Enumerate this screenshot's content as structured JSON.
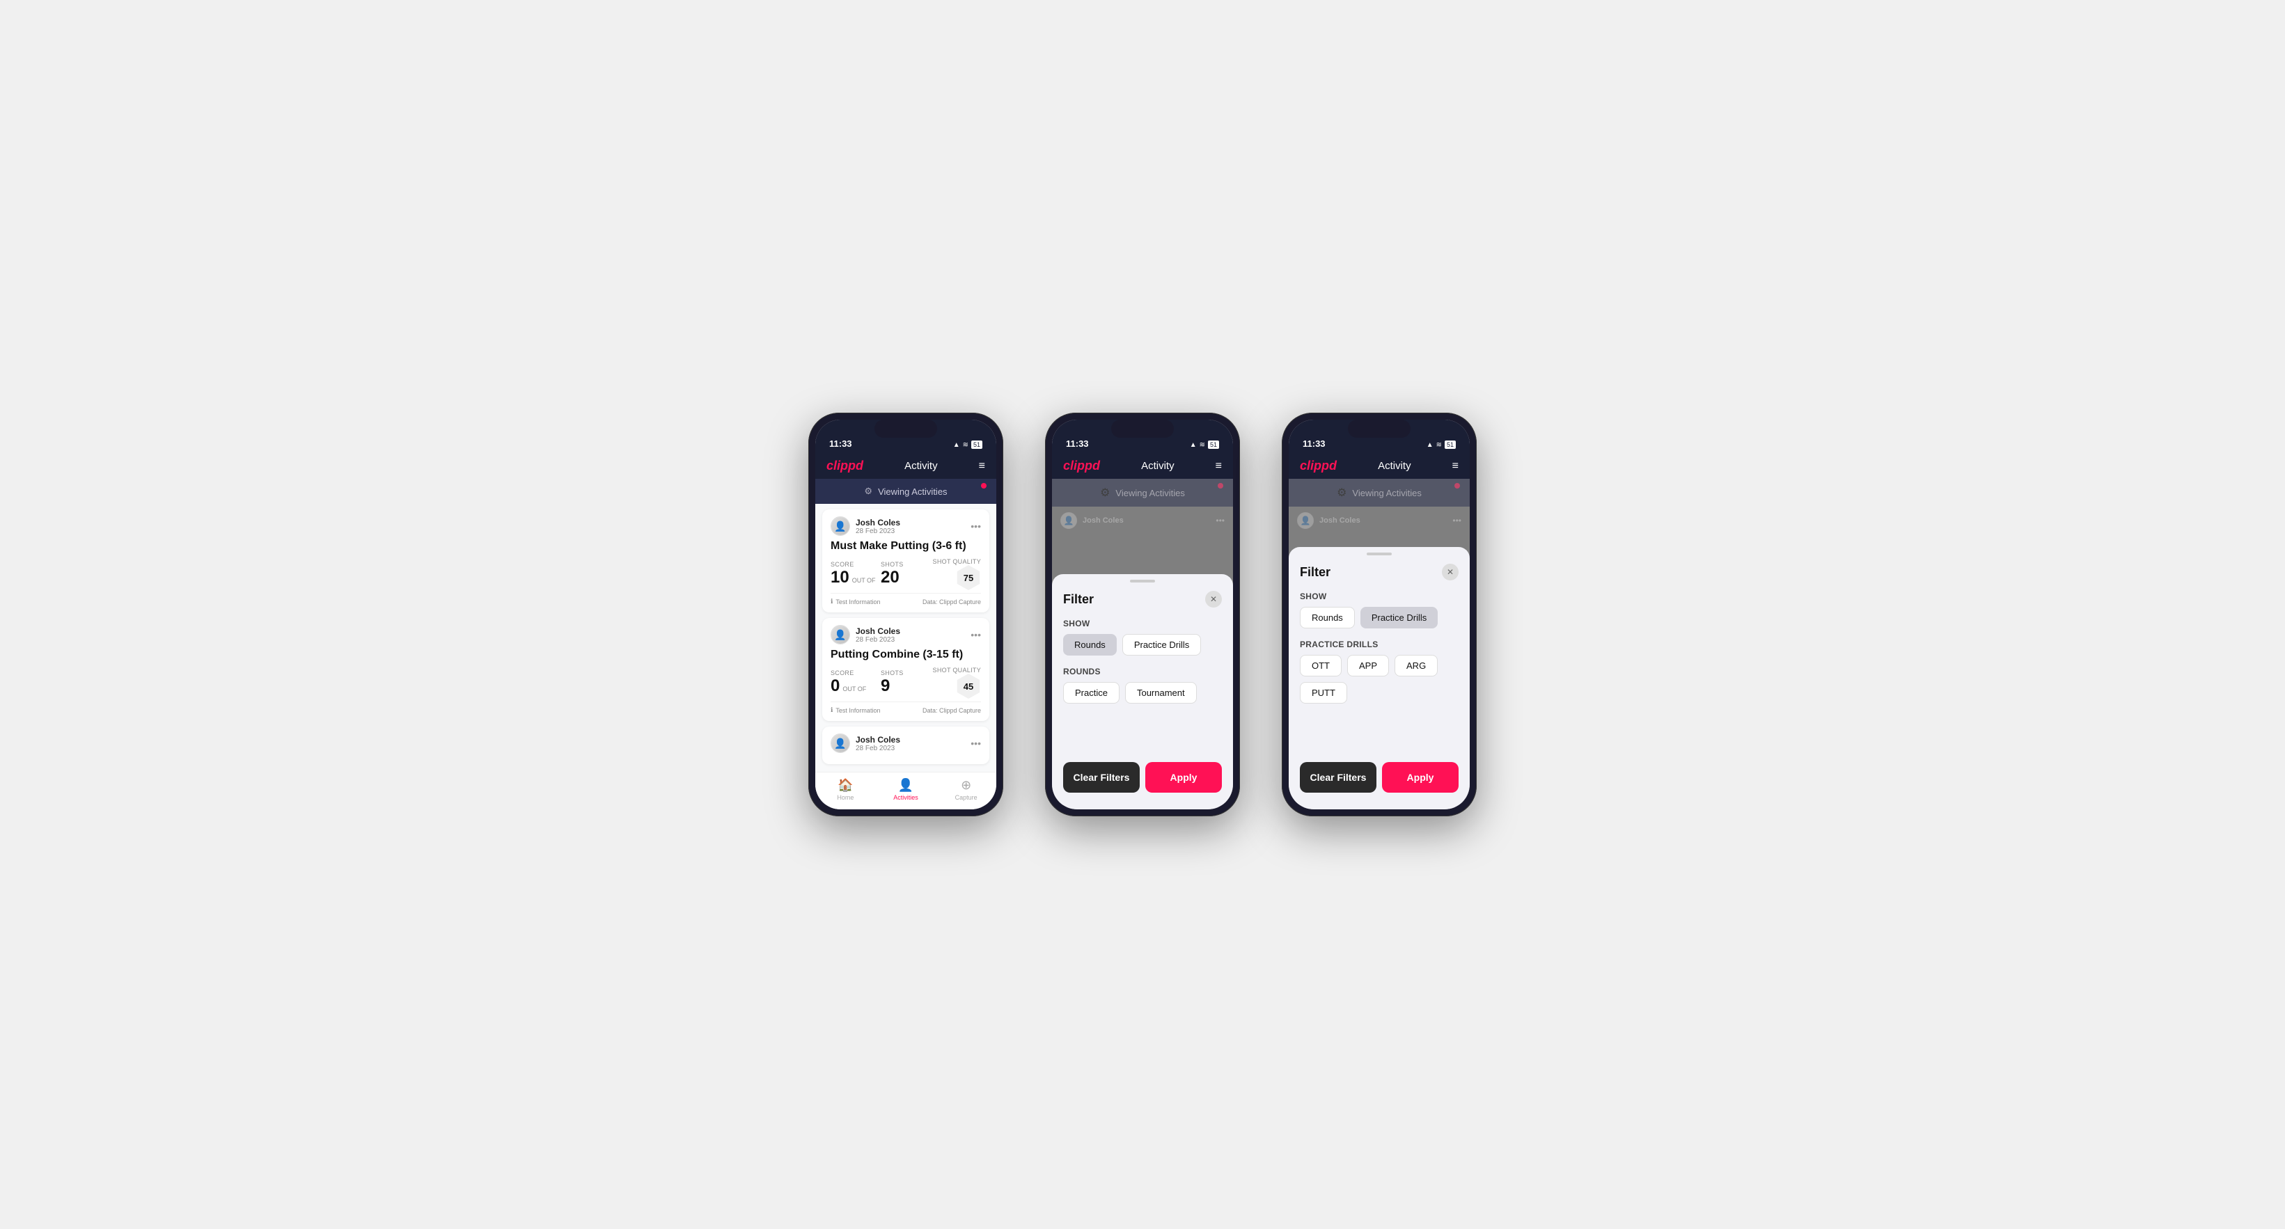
{
  "phones": [
    {
      "id": "phone1",
      "status": {
        "time": "11:33",
        "icons": "▲ ≋ 🔋"
      },
      "header": {
        "logo": "clippd",
        "title": "Activity",
        "menu": "≡"
      },
      "banner": {
        "icon": "⚙",
        "text": "Viewing Activities"
      },
      "activities": [
        {
          "user": "Josh Coles",
          "date": "28 Feb 2023",
          "title": "Must Make Putting (3-6 ft)",
          "score_label": "Score",
          "score": "10",
          "out_of": "OUT OF",
          "shots_label": "Shots",
          "shots": "20",
          "sq_label": "Shot Quality",
          "sq_value": "75",
          "footer_left": "Test Information",
          "footer_right": "Data: Clippd Capture"
        },
        {
          "user": "Josh Coles",
          "date": "28 Feb 2023",
          "title": "Putting Combine (3-15 ft)",
          "score_label": "Score",
          "score": "0",
          "out_of": "OUT OF",
          "shots_label": "Shots",
          "shots": "9",
          "sq_label": "Shot Quality",
          "sq_value": "45",
          "footer_left": "Test Information",
          "footer_right": "Data: Clippd Capture"
        },
        {
          "user": "Josh Coles",
          "date": "28 Feb 2023",
          "title": "",
          "score_label": "",
          "score": "",
          "out_of": "",
          "shots_label": "",
          "shots": "",
          "sq_label": "",
          "sq_value": "",
          "footer_left": "",
          "footer_right": ""
        }
      ],
      "nav": {
        "home": "Home",
        "activities": "Activities",
        "capture": "Capture"
      }
    },
    {
      "id": "phone2",
      "status": {
        "time": "11:33"
      },
      "header": {
        "logo": "clippd",
        "title": "Activity",
        "menu": "≡"
      },
      "banner": {
        "text": "Viewing Activities"
      },
      "filter": {
        "title": "Filter",
        "show_label": "Show",
        "show_pills": [
          {
            "label": "Rounds",
            "active": true
          },
          {
            "label": "Practice Drills",
            "active": false
          }
        ],
        "rounds_label": "Rounds",
        "round_pills": [
          {
            "label": "Practice",
            "active": false
          },
          {
            "label": "Tournament",
            "active": false
          }
        ],
        "clear_label": "Clear Filters",
        "apply_label": "Apply"
      }
    },
    {
      "id": "phone3",
      "status": {
        "time": "11:33"
      },
      "header": {
        "logo": "clippd",
        "title": "Activity",
        "menu": "≡"
      },
      "banner": {
        "text": "Viewing Activities"
      },
      "filter": {
        "title": "Filter",
        "show_label": "Show",
        "show_pills": [
          {
            "label": "Rounds",
            "active": false
          },
          {
            "label": "Practice Drills",
            "active": true
          }
        ],
        "drills_label": "Practice Drills",
        "drill_pills": [
          {
            "label": "OTT",
            "active": false
          },
          {
            "label": "APP",
            "active": false
          },
          {
            "label": "ARG",
            "active": false
          },
          {
            "label": "PUTT",
            "active": false
          }
        ],
        "clear_label": "Clear Filters",
        "apply_label": "Apply"
      }
    }
  ]
}
